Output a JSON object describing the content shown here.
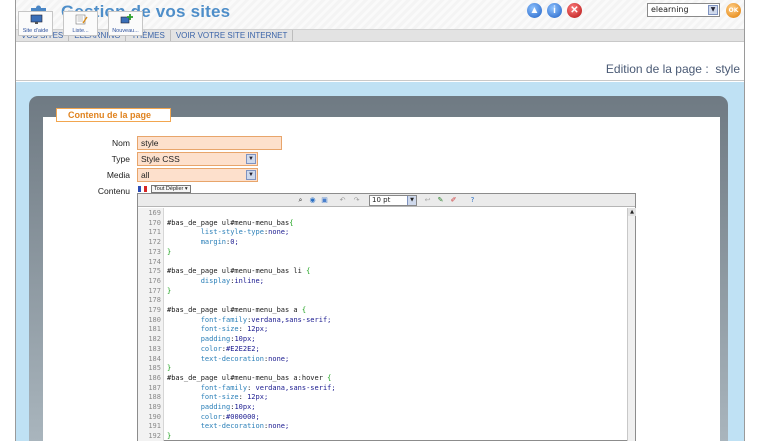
{
  "app": {
    "title": "Gestion de vos sites",
    "site_select_value": "elearning",
    "ok_label": "OK"
  },
  "nav": {
    "items": [
      "VOS SITES",
      "ELEARNING",
      "THÈMES",
      "VOIR VOTRE SITE INTERNET"
    ]
  },
  "toolbar": {
    "buttons": [
      {
        "label": "Site d'aide",
        "icon": "monitor-help-icon"
      },
      {
        "label": "Liste...",
        "icon": "list-edit-icon"
      },
      {
        "label": "Nouveau...",
        "icon": "new-page-icon"
      }
    ],
    "page_heading": "Edition de la page :  style"
  },
  "form": {
    "legend": "Contenu de la page",
    "labels": {
      "nom": "Nom",
      "type": "Type",
      "media": "Media",
      "contenu": "Contenu"
    },
    "nom_value": "style",
    "type_value": "Style CSS",
    "media_value": "all",
    "deploy_label": "Tout Déplier",
    "font_size_value": "10 pt"
  },
  "code_lines": [
    {
      "n": "169",
      "t": ""
    },
    {
      "n": "170",
      "t": "#bas_de_page ul#menu-menu_bas{"
    },
    {
      "n": "171",
      "t": "        list-style-type:none;"
    },
    {
      "n": "172",
      "t": "        margin:0;"
    },
    {
      "n": "173",
      "t": "}"
    },
    {
      "n": "174",
      "t": ""
    },
    {
      "n": "175",
      "t": "#bas_de_page ul#menu-menu_bas li {"
    },
    {
      "n": "176",
      "t": "        display:inline;"
    },
    {
      "n": "177",
      "t": "}"
    },
    {
      "n": "178",
      "t": ""
    },
    {
      "n": "179",
      "t": "#bas_de_page ul#menu-menu_bas a {"
    },
    {
      "n": "180",
      "t": "        font-family:verdana,sans-serif;"
    },
    {
      "n": "181",
      "t": "        font-size: 12px;"
    },
    {
      "n": "182",
      "t": "        padding:10px;"
    },
    {
      "n": "183",
      "t": "        color:#E2E2E2;"
    },
    {
      "n": "184",
      "t": "        text-decoration:none;"
    },
    {
      "n": "185",
      "t": "}"
    },
    {
      "n": "186",
      "t": "#bas_de_page ul#menu-menu_bas a:hover {"
    },
    {
      "n": "187",
      "t": "        font-family: verdana,sans-serif;"
    },
    {
      "n": "188",
      "t": "        font-size: 12px;"
    },
    {
      "n": "189",
      "t": "        padding:10px;"
    },
    {
      "n": "190",
      "t": "        color:#000000;"
    },
    {
      "n": "191",
      "t": "        text-decoration:none;"
    },
    {
      "n": "192",
      "t": "}"
    }
  ]
}
